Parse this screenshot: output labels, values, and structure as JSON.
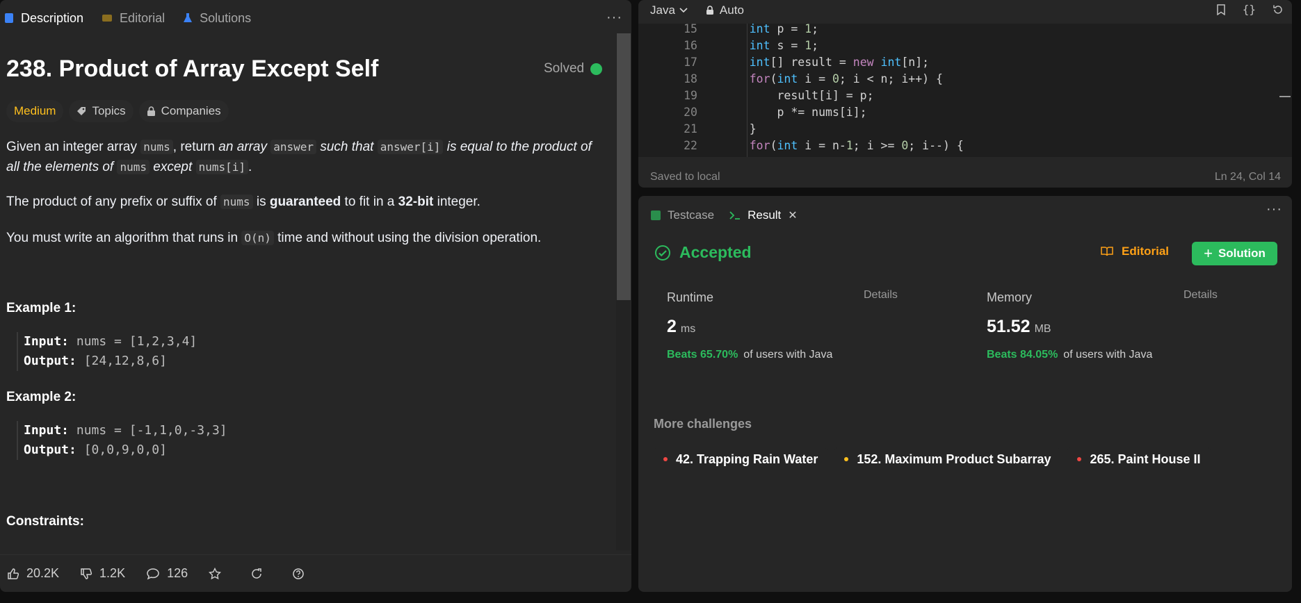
{
  "left_tabs": [
    {
      "label": "Description",
      "active": true
    },
    {
      "label": "Editorial",
      "active": false
    },
    {
      "label": "Solutions",
      "active": false
    }
  ],
  "left_more": "···",
  "problem": {
    "title": "238. Product of Array Except Self",
    "solved_label": "Solved",
    "difficulty": "Medium",
    "tag_topics": "Topics",
    "tag_companies": "Companies"
  },
  "description": {
    "p1_a": "Given an integer array ",
    "p1_code1": "nums",
    "p1_b": ", return ",
    "p1_c": "an array",
    "p1_code2": "answer",
    "p1_d": " such that ",
    "p1_code3": "answer[i]",
    "p1_e": " is equal to the product of all the elements of ",
    "p1_code4": "nums",
    "p1_f": " except ",
    "p1_code5": "nums[i]",
    "p1_g": ".",
    "p2_a": "The product of any prefix or suffix of ",
    "p2_code": "nums",
    "p2_b": " is ",
    "p2_bold1": "guaranteed",
    "p2_c": " to fit in a ",
    "p2_bold2": "32-bit",
    "p2_d": " integer.",
    "p3_a": "You must write an algorithm that runs in ",
    "p3_code": "O(n)",
    "p3_b": " time and without using the division operation."
  },
  "examples": [
    {
      "heading": "Example 1:",
      "input_label": "Input:",
      "input": "nums = [1,2,3,4]",
      "output_label": "Output:",
      "output": "[24,12,8,6]"
    },
    {
      "heading": "Example 2:",
      "input_label": "Input:",
      "input": "nums = [-1,1,0,-3,3]",
      "output_label": "Output:",
      "output": "[0,0,9,0,0]"
    }
  ],
  "constraints_heading": "Constraints:",
  "footer": {
    "likes": "20.2K",
    "dislikes": "1.2K",
    "comments": "126"
  },
  "editor": {
    "language": "Java",
    "mode": "Auto",
    "status_left": "Saved to local",
    "status_right": "Ln 24, Col 14",
    "lines": [
      {
        "n": "15",
        "code": "    int p = 1;"
      },
      {
        "n": "16",
        "code": "    int s = 1;"
      },
      {
        "n": "17",
        "code": "    int[] result = new int[n];"
      },
      {
        "n": "18",
        "code": "    for(int i = 0; i < n; i++) {"
      },
      {
        "n": "19",
        "code": "        result[i] = p;"
      },
      {
        "n": "20",
        "code": "        p *= nums[i];"
      },
      {
        "n": "21",
        "code": "    }"
      },
      {
        "n": "22",
        "code": "    for(int i = n-1; i >= 0; i--) {"
      }
    ]
  },
  "result_tabs": [
    {
      "label": "Testcase",
      "active": false
    },
    {
      "label": "Result",
      "active": true
    }
  ],
  "result": {
    "status": "Accepted",
    "editorial_label": "Editorial",
    "solution_label": "Solution",
    "runtime": {
      "label": "Runtime",
      "details": "Details",
      "value": "2",
      "unit": "ms",
      "beats": "Beats 65.70%",
      "beats_suffix": "of users with Java"
    },
    "memory": {
      "label": "Memory",
      "details": "Details",
      "value": "51.52",
      "unit": "MB",
      "beats": "Beats 84.05%",
      "beats_suffix": "of users with Java"
    },
    "more_challenges": "More challenges",
    "challenges": [
      {
        "label": "42. Trapping Rain Water",
        "color": "#ef4743"
      },
      {
        "label": "152. Maximum Product Subarray",
        "color": "#ffc01e"
      },
      {
        "label": "265. Paint House II",
        "color": "#ef4743"
      }
    ]
  },
  "colors": {
    "accent_green": "#2cbb5d",
    "accent_orange": "#ffa116",
    "medium": "#ffc01e",
    "hard": "#ef4743"
  }
}
